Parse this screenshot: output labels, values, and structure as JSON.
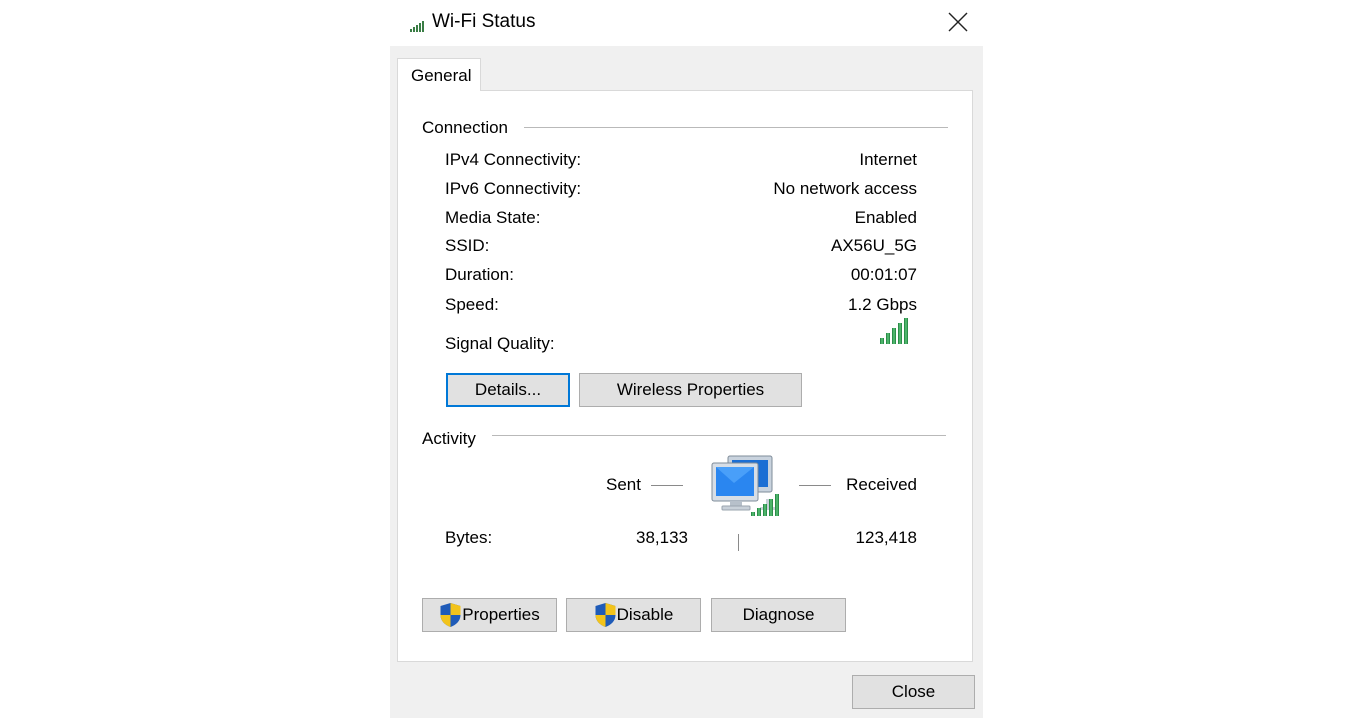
{
  "window": {
    "title": "Wi-Fi Status",
    "title_icon": "wifi-signal-icon",
    "close_icon": "close-icon"
  },
  "tabs": [
    {
      "label": "General",
      "selected": true
    }
  ],
  "connection": {
    "heading": "Connection",
    "rows": [
      {
        "label": "IPv4 Connectivity:",
        "value": "Internet"
      },
      {
        "label": "IPv6 Connectivity:",
        "value": "No network access"
      },
      {
        "label": "Media State:",
        "value": "Enabled"
      },
      {
        "label": "SSID:",
        "value": "AX56U_5G"
      },
      {
        "label": "Duration:",
        "value": "00:01:07"
      },
      {
        "label": "Speed:",
        "value": "1.2 Gbps"
      }
    ],
    "signal_label": "Signal Quality:",
    "signal_bars": 5,
    "signal_icon": "signal-strength-icon",
    "details_button": "Details...",
    "wireless_properties_button": "Wireless Properties"
  },
  "activity": {
    "heading": "Activity",
    "sent_label": "Sent",
    "received_label": "Received",
    "bytes_label": "Bytes:",
    "bytes_sent": "38,133",
    "bytes_received": "123,418",
    "network_icon": "network-computers-icon"
  },
  "buttons": {
    "properties": "Properties",
    "disable": "Disable",
    "diagnose": "Diagnose",
    "close": "Close"
  },
  "colors": {
    "accent": "#0078d7",
    "signal_green": "#2e9e4f",
    "shield_blue": "#1f5bb8",
    "shield_yellow": "#f2c31b"
  }
}
